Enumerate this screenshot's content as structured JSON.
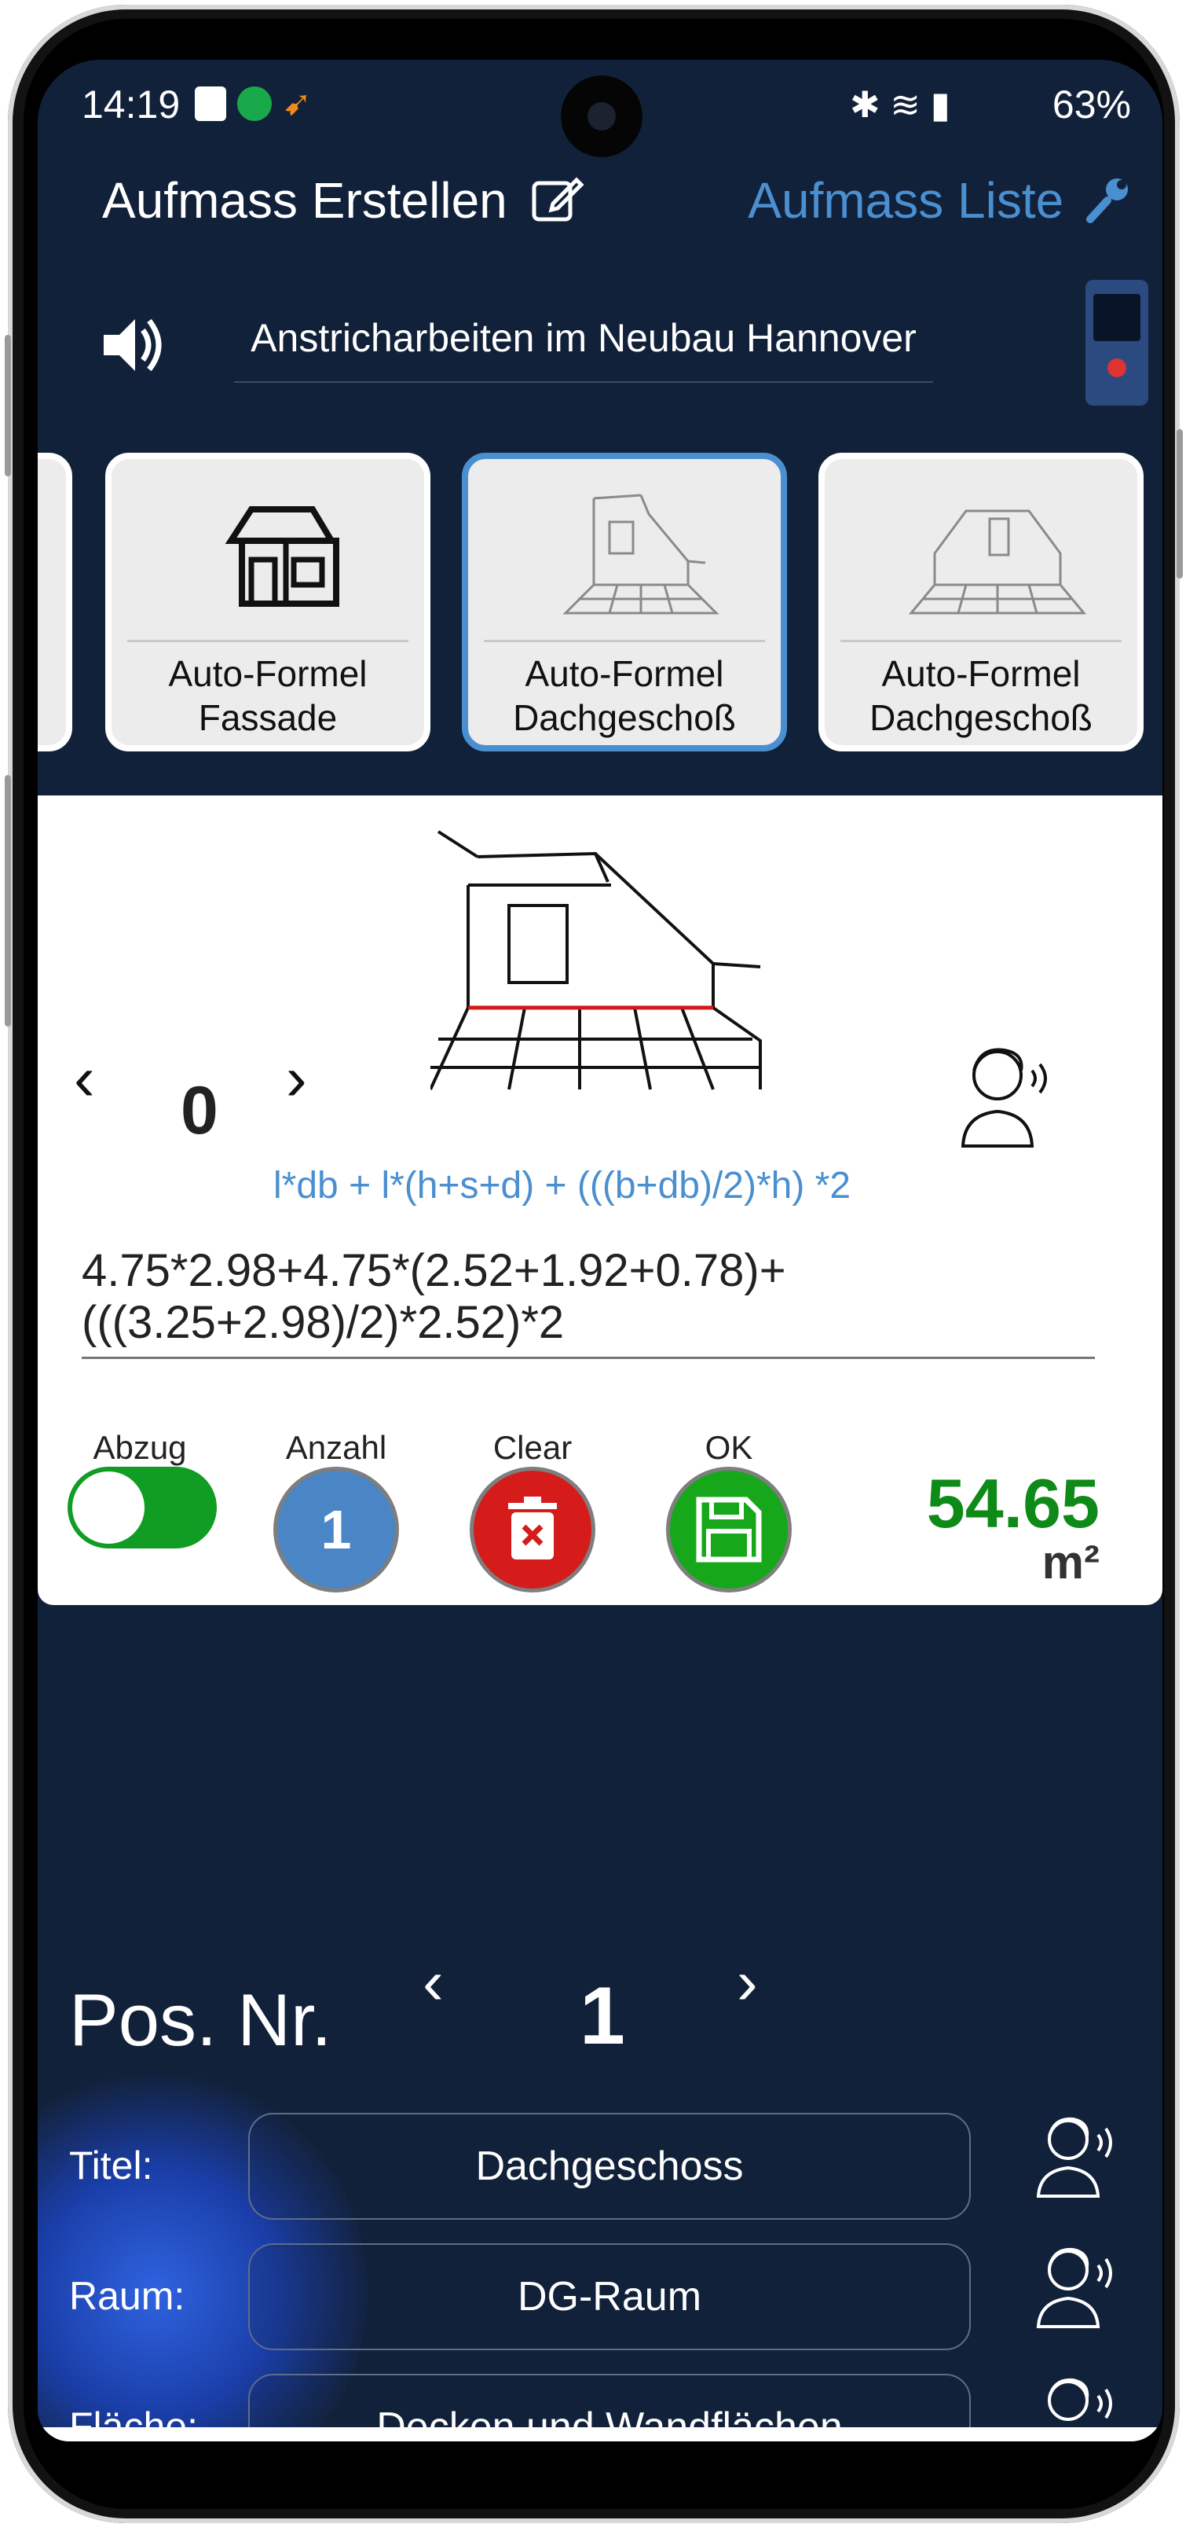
{
  "status": {
    "time": "14:19",
    "battery": "63%"
  },
  "header": {
    "left_title": "Aufmass Erstellen",
    "right_title": "Aufmass Liste"
  },
  "project": {
    "title": "Anstricharbeiten im Neubau Hannover"
  },
  "cards": [
    {
      "label_line1": "Auto-Formel",
      "label_line2": "Fassade",
      "icon": "house-icon"
    },
    {
      "label_line1": "Auto-Formel",
      "label_line2": "Dachgeschoß",
      "icon": "attic-room-icon",
      "selected": true
    },
    {
      "label_line1": "Auto-Formel",
      "label_line2": "Dachgeschoß",
      "icon": "attic-room-icon-2"
    }
  ],
  "panel": {
    "counter": "0",
    "formula": "l*db + l*(h+s+d) + (((b+db)/2)*h) *2",
    "calculation": "4.75*2.98+4.75*(2.52+1.92+0.78)+(((3.25+2.98)/2)*2.52)*2",
    "controls": {
      "abzug_label": "Abzug",
      "anzahl_label": "Anzahl",
      "anzahl_value": "1",
      "clear_label": "Clear",
      "ok_label": "OK"
    },
    "result_value": "54.65",
    "result_unit": "m²"
  },
  "position": {
    "label": "Pos. Nr.",
    "number": "1"
  },
  "fields": [
    {
      "label": "Titel:",
      "value": "Dachgeschoss"
    },
    {
      "label": "Raum:",
      "value": "DG-Raum"
    },
    {
      "label": "Fläche:",
      "value": "Decken und Wandflächen"
    }
  ],
  "colors": {
    "background": "#12213a",
    "accent": "#4a8fd0",
    "toggle": "#119c23",
    "clear": "#d61b1b",
    "ok": "#16a81a",
    "result": "#0d8a17"
  }
}
